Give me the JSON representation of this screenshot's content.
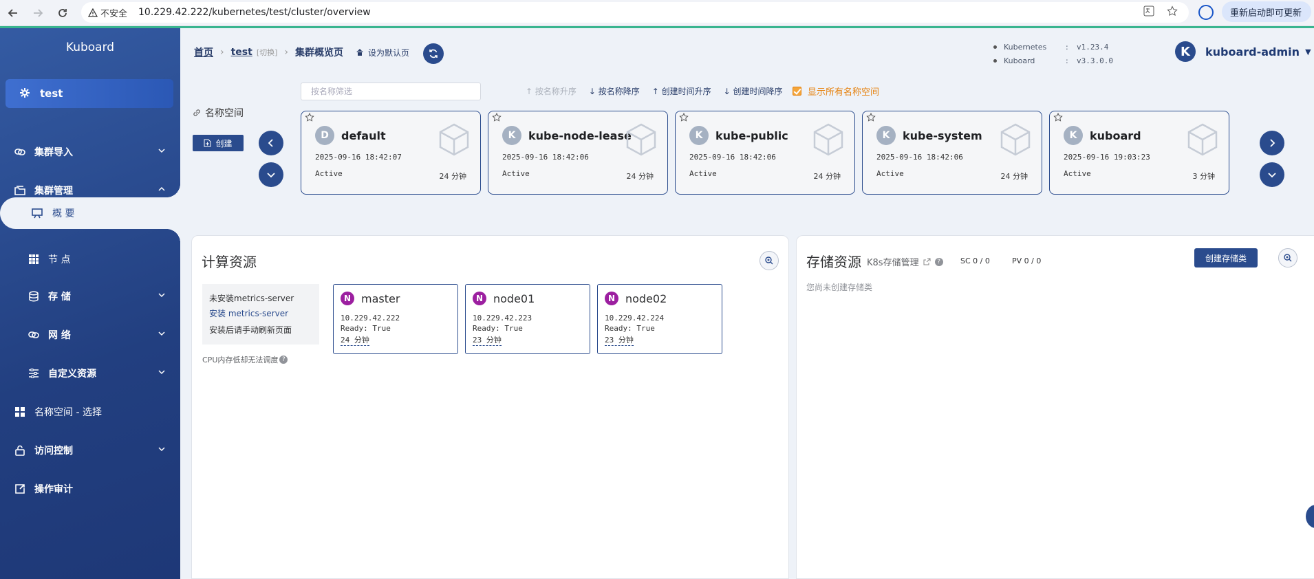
{
  "browser": {
    "insecure_label": "不安全",
    "url": "10.229.42.222/kubernetes/test/cluster/overview",
    "update_label": "重新启动即可更新"
  },
  "sidebar": {
    "brand": "Kuboard",
    "cluster": "test",
    "items": [
      {
        "label": "集群导入"
      },
      {
        "label": "集群管理"
      },
      {
        "label": "概 要"
      },
      {
        "label": "节 点"
      },
      {
        "label": "存 储"
      },
      {
        "label": "网 络"
      },
      {
        "label": "自定义资源"
      },
      {
        "label": "名称空间 - 选择"
      },
      {
        "label": "访问控制"
      },
      {
        "label": "操作审计"
      }
    ]
  },
  "header": {
    "breadcrumb": {
      "home": "首页",
      "cluster": "test",
      "switch": "[切换]",
      "current": "集群概览页"
    },
    "set_default": "设为默认页",
    "versions": [
      {
        "key": "Kubernetes",
        "value": "v1.23.4"
      },
      {
        "key": "Kuboard",
        "value": "v3.3.0.0"
      }
    ],
    "user": {
      "initial": "K",
      "name": "kuboard-admin"
    }
  },
  "namespaces": {
    "label": "名称空间",
    "create_label": "创建",
    "filter_placeholder": "按名称筛选",
    "sort": [
      "按名称升序",
      "按名称降序",
      "创建时间升序",
      "创建时间降序"
    ],
    "show_all": "显示所有名称空间",
    "cards": [
      {
        "letter": "D",
        "name": "default",
        "created": "2025-09-16 18:42:07",
        "status": "Active",
        "age": "24 分钟"
      },
      {
        "letter": "K",
        "name": "kube-node-lease",
        "created": "2025-09-16 18:42:06",
        "status": "Active",
        "age": "24 分钟"
      },
      {
        "letter": "K",
        "name": "kube-public",
        "created": "2025-09-16 18:42:06",
        "status": "Active",
        "age": "24 分钟"
      },
      {
        "letter": "K",
        "name": "kube-system",
        "created": "2025-09-16 18:42:06",
        "status": "Active",
        "age": "24 分钟"
      },
      {
        "letter": "K",
        "name": "kuboard",
        "created": "2025-09-16 19:03:23",
        "status": "Active",
        "age": "3 分钟"
      }
    ]
  },
  "compute": {
    "title": "计算资源",
    "metrics": {
      "not_installed": "未安装metrics-server",
      "install_link": "安装 metrics-server",
      "refresh_note": "安装后请手动刷新页面"
    },
    "cpu_note": "CPU内存低却无法调度",
    "nodes": [
      {
        "badge": "N",
        "name": "master",
        "ip": "10.229.42.222",
        "ready": "Ready: True",
        "age": "24 分钟"
      },
      {
        "badge": "N",
        "name": "node01",
        "ip": "10.229.42.223",
        "ready": "Ready: True",
        "age": "23 分钟"
      },
      {
        "badge": "N",
        "name": "node02",
        "ip": "10.229.42.224",
        "ready": "Ready: True",
        "age": "23 分钟"
      }
    ]
  },
  "storage": {
    "title": "存储资源",
    "subtitle": "K8s存储管理",
    "sc_count": "SC 0 / 0",
    "pv_count": "PV 0 / 0",
    "create_label": "创建存储类",
    "empty_text": "您尚未创建存储类"
  },
  "colors": {
    "primary": "#2a4b8d",
    "warning": "#e6820e",
    "node_badge": "#9c1fa0"
  }
}
